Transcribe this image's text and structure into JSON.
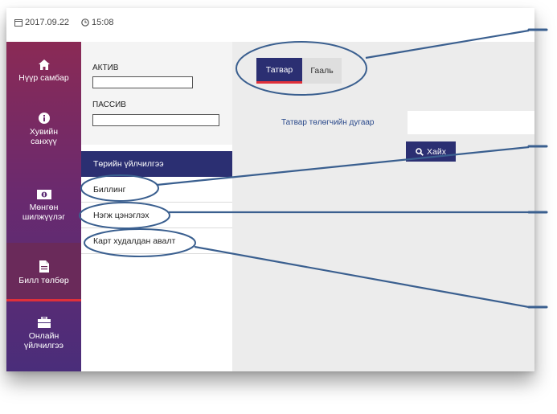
{
  "topbar": {
    "date": "2017.09.22",
    "time": "15:08"
  },
  "leftnav": {
    "items": [
      {
        "label1": "Нүүр самбар",
        "label2": "",
        "icon": "home-icon"
      },
      {
        "label1": "Хувийн",
        "label2": "санхүү",
        "icon": "info-icon"
      },
      {
        "label1": "Мөнгөн",
        "label2": "шилжүүлэг",
        "icon": "money-icon"
      },
      {
        "label1": "Билл төлбөр",
        "label2": "",
        "icon": "bill-icon",
        "active": true
      },
      {
        "label1": "Онлайн",
        "label2": "үйлчилгээ",
        "icon": "briefcase-icon"
      }
    ]
  },
  "card": {
    "active_label": "АКТИВ",
    "passive_label": "ПАССИВ"
  },
  "menu": {
    "header": "Төрийн үйлчилгээ",
    "items": [
      "Биллинг",
      "Нэгж цэнэглэх",
      "Карт худалдан авалт"
    ]
  },
  "tabs": [
    "Татвар",
    "Гааль"
  ],
  "form": {
    "field_label": "Татвар төлөгчийн дугаар",
    "field_value": "",
    "search_label": "Хайх"
  },
  "colors": {
    "brand": "#2b2f72",
    "accent": "#e0303a",
    "annotation": "#3a5f8f"
  }
}
